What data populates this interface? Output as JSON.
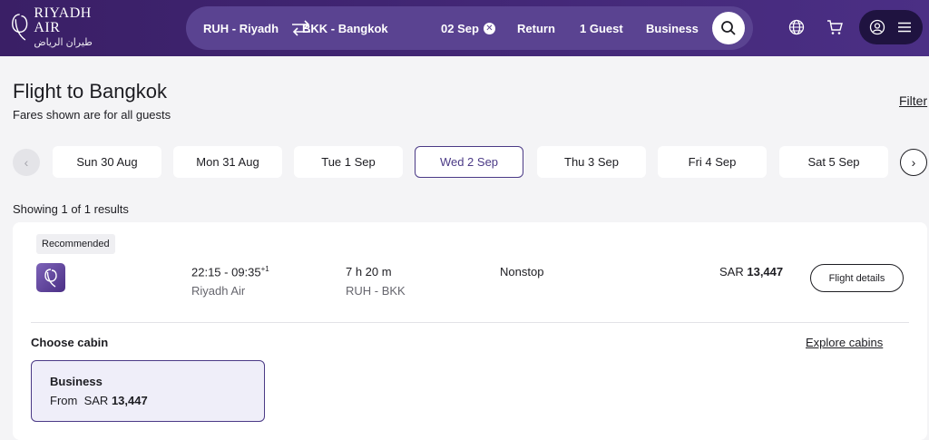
{
  "brand": {
    "name_en": "RIYADH AIR",
    "name_ar": "طيران الرياض"
  },
  "search": {
    "origin": "RUH - Riyadh",
    "destination": "BKK - Bangkok",
    "date": "02 Sep",
    "trip_type": "Return",
    "guests": "1 Guest",
    "cabin": "Business",
    "swap_icon": "swap-arrows-icon",
    "clear_icon": "close-circle-icon",
    "search_icon": "search-icon"
  },
  "header_icons": [
    "globe-icon",
    "cart-icon",
    "user-icon",
    "menu-icon"
  ],
  "page": {
    "title": "Flight to Bangkok",
    "subtitle": "Fares shown are for all guests",
    "filter_label": "Filter",
    "results_count": "Showing 1 of 1 results"
  },
  "dates": [
    {
      "label": "Sun 30 Aug",
      "selected": false
    },
    {
      "label": "Mon 31 Aug",
      "selected": false
    },
    {
      "label": "Tue 1 Sep",
      "selected": false
    },
    {
      "label": "Wed 2 Sep",
      "selected": true
    },
    {
      "label": "Thu 3 Sep",
      "selected": false
    },
    {
      "label": "Fri 4 Sep",
      "selected": false
    },
    {
      "label": "Sat 5 Sep",
      "selected": false
    }
  ],
  "result": {
    "badge": "Recommended",
    "times": "22:15 - 09:35",
    "day_offset": "+1",
    "airline": "Riyadh Air",
    "duration": "7 h 20 m",
    "route": "RUH - BKK",
    "stops": "Nonstop",
    "price_currency": "SAR",
    "price_amount": "13,447",
    "details_label": "Flight details",
    "choose_cabin_label": "Choose cabin",
    "explore_label": "Explore cabins",
    "cabin": {
      "name": "Business",
      "from_label": "From",
      "currency": "SAR",
      "amount": "13,447"
    }
  },
  "colors": {
    "header": "#402572",
    "accent": "#4b3a86",
    "background": "#f4f4f6"
  }
}
